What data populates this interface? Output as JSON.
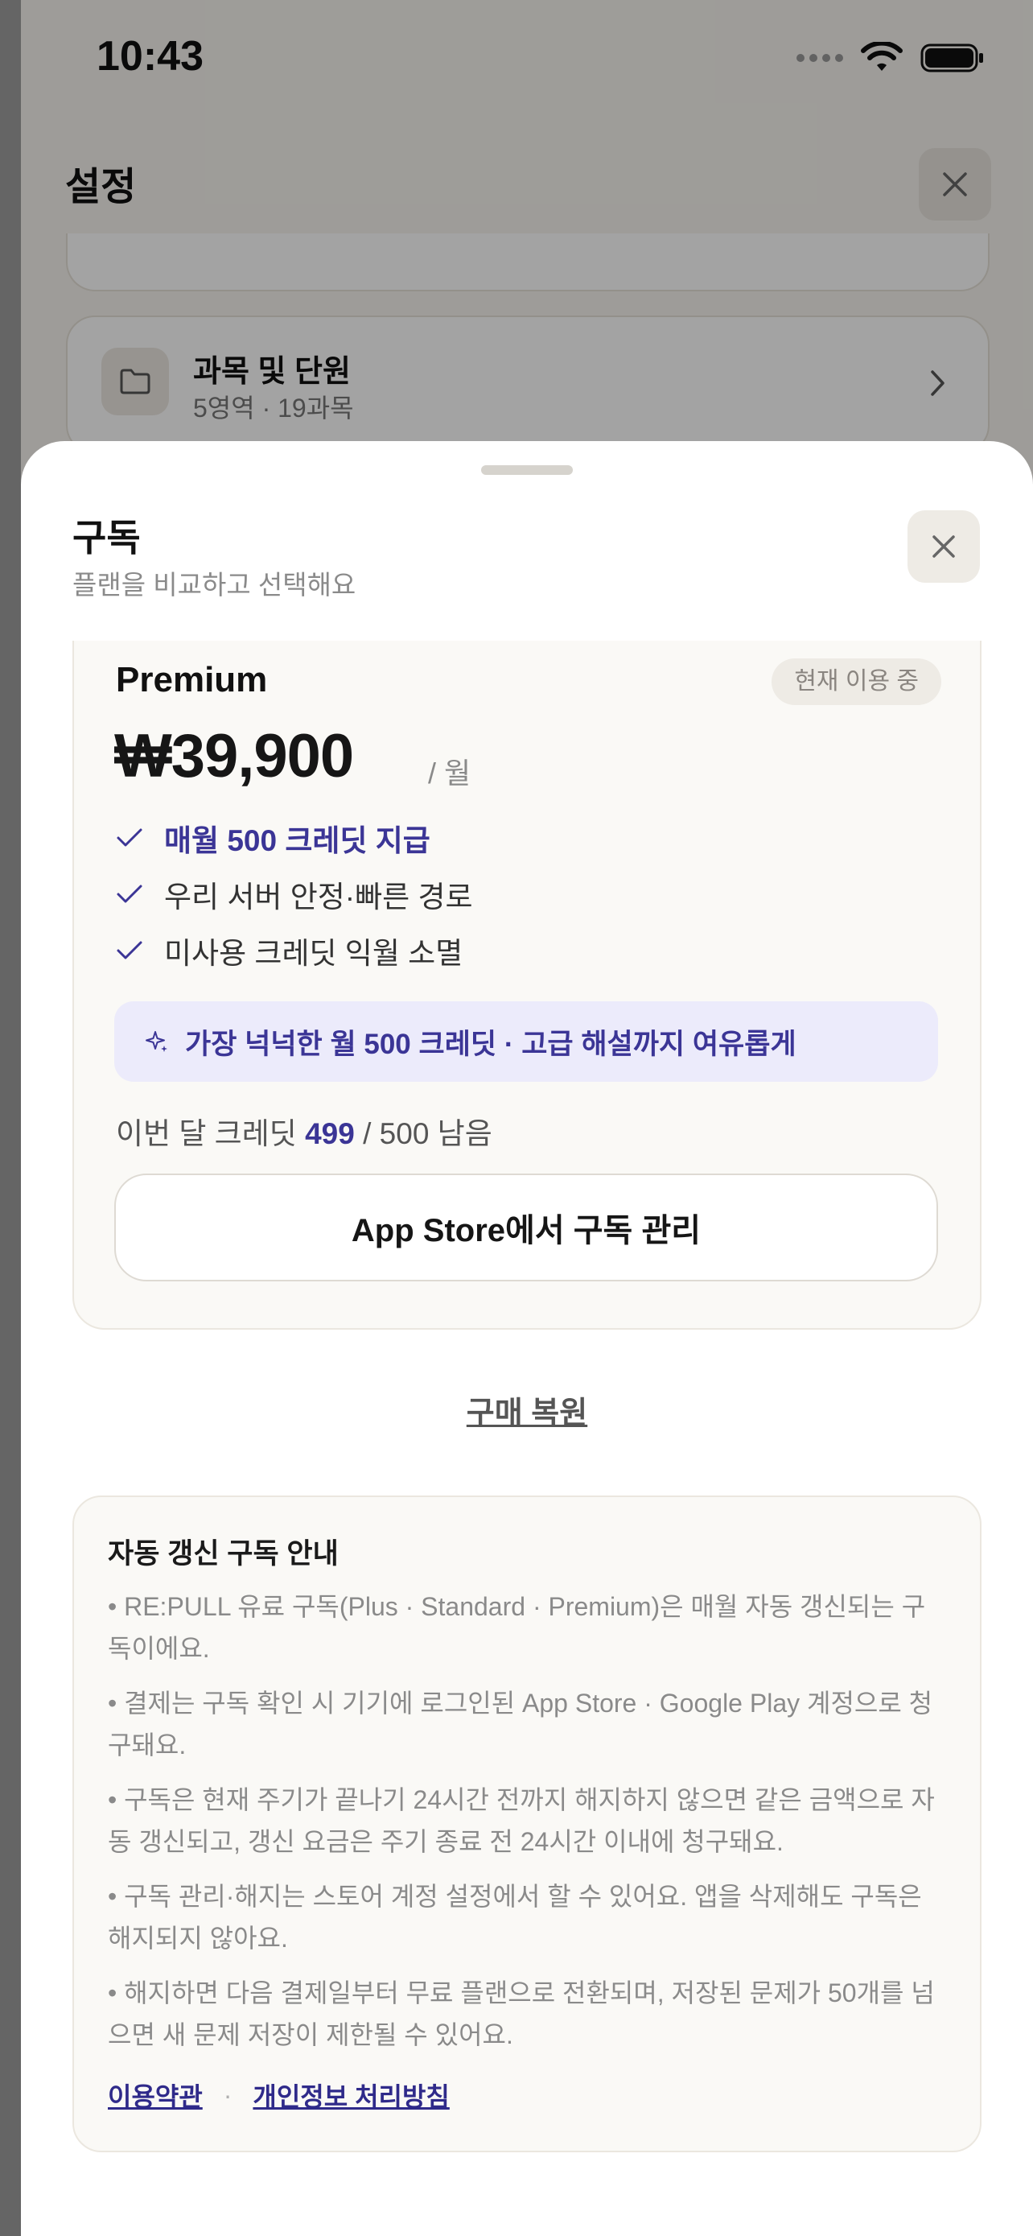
{
  "status_bar": {
    "time": "10:43"
  },
  "settings_screen": {
    "title": "설정",
    "subjects_card": {
      "title": "과목 및 단원",
      "subtitle": "5영역 · 19과목"
    }
  },
  "sheet": {
    "title": "구독",
    "subtitle": "플랜을 비교하고 선택해요",
    "plan": {
      "name": "Premium",
      "badge": "현재 이용 중",
      "price": "₩39,900",
      "price_unit": "/ 월",
      "features": [
        "매월 500 크레딧 지급",
        "우리 서버 안정·빠른 경로",
        "미사용 크레딧 익월 소멸"
      ],
      "promo": "가장 넉넉한 월 500 크레딧 · 고급 해설까지 여유롭게",
      "credits_prefix": "이번 달 크레딧",
      "credits_remaining": "499",
      "credits_suffix": "/ 500 남음",
      "manage_label": "App Store에서 구독 관리"
    },
    "restore_label": "구매 복원",
    "info": {
      "title": "자동 갱신 구독 안내",
      "items": [
        "• RE:PULL 유료 구독(Plus · Standard · Premium)은 매월 자동 갱신되는 구독이에요.",
        "• 결제는 구독 확인 시 기기에 로그인된 App Store · Google Play 계정으로 청구돼요.",
        "• 구독은 현재 주기가 끝나기 24시간 전까지 해지하지 않으면 같은 금액으로 자동 갱신되고, 갱신 요금은 주기 종료 전 24시간 이내에 청구돼요.",
        "• 구독 관리·해지는 스토어 계정 설정에서 할 수 있어요. 앱을 삭제해도 구독은 해지되지 않아요.",
        "• 해지하면 다음 결제일부터 무료 플랜으로 전환되며, 저장된 문제가 50개를 넘으면 새 문제 저장이 제한될 수 있어요."
      ],
      "terms_label": "이용약관",
      "separator": "·",
      "privacy_label": "개인정보 처리방침"
    }
  },
  "colors": {
    "accent": "#3b3596",
    "promo_bg": "#ecebfb",
    "card_bg": "#faf9f6"
  }
}
